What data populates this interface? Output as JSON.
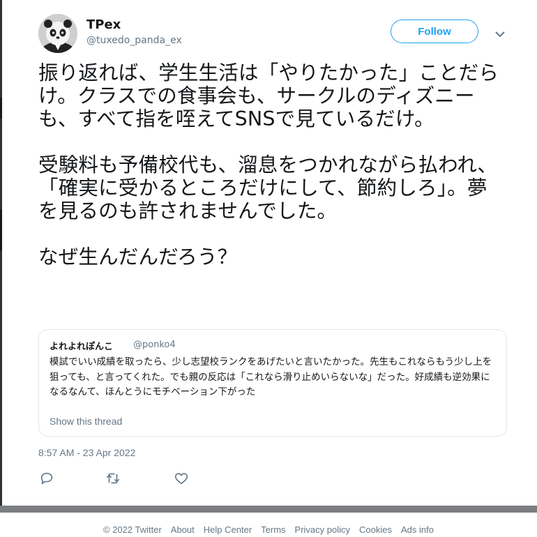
{
  "tweet": {
    "author_name": "TPex",
    "author_handle": "@tuxedo_panda_ex",
    "follow_label": "Follow",
    "text": "振り返れば、学生生活は「やりたかった」ことだらけ。クラスでの食事会も、サークルのディズニーも、すべて指を咥えてSNSで見ているだけ。\n\n受験料も予備校代も、溜息をつかれながら払われ、「確実に受かるところだけにして、節約しろ」。夢を見るのも許されませんでした。\n\nなぜ生んだんだろう？",
    "timestamp": "8:57 AM - 23 Apr 2022"
  },
  "quoted_tweet": {
    "author_name": "よれよれぽんこ",
    "author_handle": "@ponko4",
    "text": "模試でいい成績を取ったら、少し志望校ランクをあげたいと言いたかった。先生もこれならもう少し上を狙っても、と言ってくれた。でも親の反応は「これなら滑り止めいらないな」だった。好成績も逆効果になるなんて、ほんとうにモチベーション下がった",
    "link_label": "Show this thread"
  },
  "actions": {
    "reply_icon": "reply-icon",
    "retweet_icon": "retweet-icon",
    "like_icon": "heart-icon"
  },
  "footer": {
    "links": [
      "© 2022 Twitter",
      "About",
      "Help Center",
      "Terms",
      "Privacy policy",
      "Cookies",
      "Ads info"
    ]
  },
  "colors": {
    "accent": "#1da1f2",
    "secondary_text": "#657786",
    "border": "#e1e8ed"
  }
}
